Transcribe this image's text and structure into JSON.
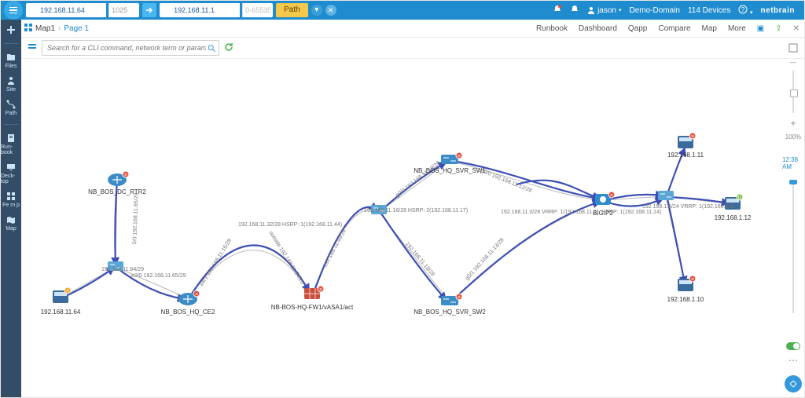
{
  "topbar": {
    "source_ip": "192.168.11.64",
    "source_port": "1025",
    "dest_ip": "192.168.11.1",
    "dest_port": "0-65535",
    "path_label": "Path",
    "user": "jason",
    "domain": "Demo-Domain",
    "device_count": "114 Devices",
    "brand": "netbrain"
  },
  "breadcrumb": {
    "root": "Map1",
    "page": "Page 1"
  },
  "menu": {
    "runbook": "Runbook",
    "dashboard": "Dashboard",
    "qapp": "Qapp",
    "compare": "Compare",
    "map": "Map",
    "more": "More"
  },
  "search": {
    "placeholder": "Search for a CLI command, network term or parameter"
  },
  "leftnav": {
    "files": "Files",
    "site": "Site",
    "path": "Path",
    "runbook": "Run-book",
    "desktop": "Deck-top",
    "map": "Map"
  },
  "zoom": {
    "level": "100%"
  },
  "timeline": {
    "time": "12:38 AM"
  },
  "nodes": {
    "n1": {
      "label": "192.168.11.64"
    },
    "n2": {
      "label": "NB_BOS_DC_RTR2"
    },
    "n3": {
      "label": "NB_BOS_HQ_CE2"
    },
    "n4": {
      "label": "NB-BOS-HQ-FW1/vASA1/act"
    },
    "n5": {
      "label": "NB_BOS_HQ_SVR_SW1"
    },
    "n6": {
      "label": "NB_BOS_HQ_SVR_SW2"
    },
    "n7": {
      "label": "BIGIP2"
    },
    "n8": {
      "label": "192.168.1.11"
    },
    "n9": {
      "label": "192.168.1.12"
    },
    "n10": {
      "label": "192.168.1.10"
    }
  },
  "edges": {
    "e1": "192.168.11.64/29",
    "e2": "e2/0 192.168.11.65/29",
    "e3": "192.168.11.32/28\nHSRP: 1(192.168.11.44)",
    "e4": "e4/1 192.168.11.16/28",
    "e5": "outside 192.168.11.54/28",
    "e6": "192.168.11.48/28",
    "e7": "192.168.11.16/28\nHSRP: 2(192.168.11.17)",
    "e8": "g0/0 192.168.11.19/28",
    "e9": "192.168.11.18/28",
    "e10": "g0/1 192.168.11.13/28",
    "e11": "g0/0 192.168.11.12/28",
    "e12": "192.168.11.0/28\nVRRP: 1(192.168.11.1), HSRP: 1(192.168.11.14)",
    "e13": "192.168.1.0/24\nVRRP: 1(192.168.1.1)",
    "e14": "0/0 192.168.11.65/29"
  }
}
